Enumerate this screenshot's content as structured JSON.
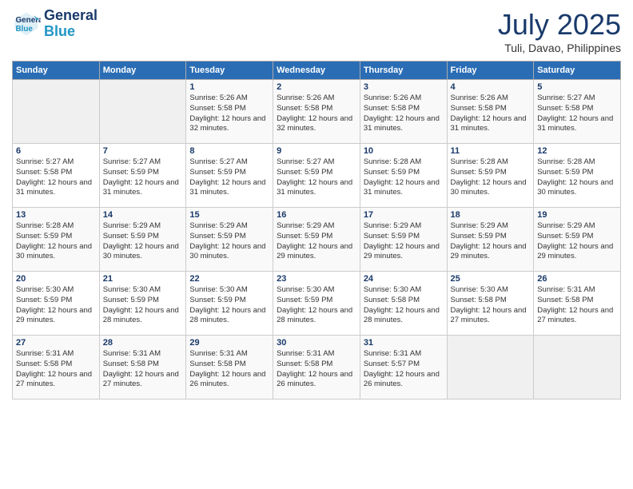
{
  "header": {
    "logo_line1": "General",
    "logo_line2": "Blue",
    "month_title": "July 2025",
    "location": "Tuli, Davao, Philippines"
  },
  "weekdays": [
    "Sunday",
    "Monday",
    "Tuesday",
    "Wednesday",
    "Thursday",
    "Friday",
    "Saturday"
  ],
  "weeks": [
    [
      {
        "day": "",
        "info": ""
      },
      {
        "day": "",
        "info": ""
      },
      {
        "day": "1",
        "info": "Sunrise: 5:26 AM\nSunset: 5:58 PM\nDaylight: 12 hours and 32 minutes."
      },
      {
        "day": "2",
        "info": "Sunrise: 5:26 AM\nSunset: 5:58 PM\nDaylight: 12 hours and 32 minutes."
      },
      {
        "day": "3",
        "info": "Sunrise: 5:26 AM\nSunset: 5:58 PM\nDaylight: 12 hours and 31 minutes."
      },
      {
        "day": "4",
        "info": "Sunrise: 5:26 AM\nSunset: 5:58 PM\nDaylight: 12 hours and 31 minutes."
      },
      {
        "day": "5",
        "info": "Sunrise: 5:27 AM\nSunset: 5:58 PM\nDaylight: 12 hours and 31 minutes."
      }
    ],
    [
      {
        "day": "6",
        "info": "Sunrise: 5:27 AM\nSunset: 5:58 PM\nDaylight: 12 hours and 31 minutes."
      },
      {
        "day": "7",
        "info": "Sunrise: 5:27 AM\nSunset: 5:59 PM\nDaylight: 12 hours and 31 minutes."
      },
      {
        "day": "8",
        "info": "Sunrise: 5:27 AM\nSunset: 5:59 PM\nDaylight: 12 hours and 31 minutes."
      },
      {
        "day": "9",
        "info": "Sunrise: 5:27 AM\nSunset: 5:59 PM\nDaylight: 12 hours and 31 minutes."
      },
      {
        "day": "10",
        "info": "Sunrise: 5:28 AM\nSunset: 5:59 PM\nDaylight: 12 hours and 31 minutes."
      },
      {
        "day": "11",
        "info": "Sunrise: 5:28 AM\nSunset: 5:59 PM\nDaylight: 12 hours and 30 minutes."
      },
      {
        "day": "12",
        "info": "Sunrise: 5:28 AM\nSunset: 5:59 PM\nDaylight: 12 hours and 30 minutes."
      }
    ],
    [
      {
        "day": "13",
        "info": "Sunrise: 5:28 AM\nSunset: 5:59 PM\nDaylight: 12 hours and 30 minutes."
      },
      {
        "day": "14",
        "info": "Sunrise: 5:29 AM\nSunset: 5:59 PM\nDaylight: 12 hours and 30 minutes."
      },
      {
        "day": "15",
        "info": "Sunrise: 5:29 AM\nSunset: 5:59 PM\nDaylight: 12 hours and 30 minutes."
      },
      {
        "day": "16",
        "info": "Sunrise: 5:29 AM\nSunset: 5:59 PM\nDaylight: 12 hours and 29 minutes."
      },
      {
        "day": "17",
        "info": "Sunrise: 5:29 AM\nSunset: 5:59 PM\nDaylight: 12 hours and 29 minutes."
      },
      {
        "day": "18",
        "info": "Sunrise: 5:29 AM\nSunset: 5:59 PM\nDaylight: 12 hours and 29 minutes."
      },
      {
        "day": "19",
        "info": "Sunrise: 5:29 AM\nSunset: 5:59 PM\nDaylight: 12 hours and 29 minutes."
      }
    ],
    [
      {
        "day": "20",
        "info": "Sunrise: 5:30 AM\nSunset: 5:59 PM\nDaylight: 12 hours and 29 minutes."
      },
      {
        "day": "21",
        "info": "Sunrise: 5:30 AM\nSunset: 5:59 PM\nDaylight: 12 hours and 28 minutes."
      },
      {
        "day": "22",
        "info": "Sunrise: 5:30 AM\nSunset: 5:59 PM\nDaylight: 12 hours and 28 minutes."
      },
      {
        "day": "23",
        "info": "Sunrise: 5:30 AM\nSunset: 5:59 PM\nDaylight: 12 hours and 28 minutes."
      },
      {
        "day": "24",
        "info": "Sunrise: 5:30 AM\nSunset: 5:58 PM\nDaylight: 12 hours and 28 minutes."
      },
      {
        "day": "25",
        "info": "Sunrise: 5:30 AM\nSunset: 5:58 PM\nDaylight: 12 hours and 27 minutes."
      },
      {
        "day": "26",
        "info": "Sunrise: 5:31 AM\nSunset: 5:58 PM\nDaylight: 12 hours and 27 minutes."
      }
    ],
    [
      {
        "day": "27",
        "info": "Sunrise: 5:31 AM\nSunset: 5:58 PM\nDaylight: 12 hours and 27 minutes."
      },
      {
        "day": "28",
        "info": "Sunrise: 5:31 AM\nSunset: 5:58 PM\nDaylight: 12 hours and 27 minutes."
      },
      {
        "day": "29",
        "info": "Sunrise: 5:31 AM\nSunset: 5:58 PM\nDaylight: 12 hours and 26 minutes."
      },
      {
        "day": "30",
        "info": "Sunrise: 5:31 AM\nSunset: 5:58 PM\nDaylight: 12 hours and 26 minutes."
      },
      {
        "day": "31",
        "info": "Sunrise: 5:31 AM\nSunset: 5:57 PM\nDaylight: 12 hours and 26 minutes."
      },
      {
        "day": "",
        "info": ""
      },
      {
        "day": "",
        "info": ""
      }
    ]
  ]
}
